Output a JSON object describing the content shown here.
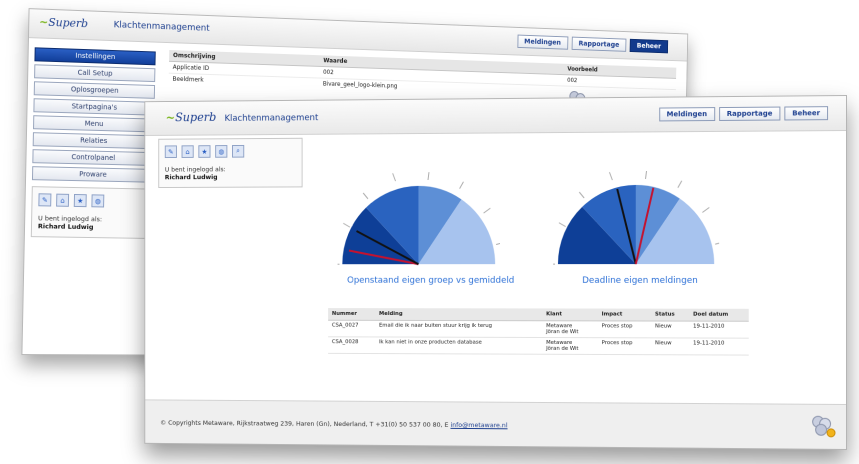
{
  "app": {
    "logo_text": "Superb",
    "title": "Klachtenmanagement"
  },
  "top_nav": [
    "Meldingen",
    "Rapportage",
    "Beheer"
  ],
  "back_window": {
    "sidebar_items": [
      "Instellingen",
      "Call Setup",
      "Oplosgroepen",
      "Startpagina's",
      "Menu",
      "Relaties",
      "Controlpanel",
      "Proware"
    ],
    "active_item": "Instellingen",
    "logged_in_label": "U bent ingelogd als:",
    "user_name": "Richard Ludwig",
    "table": {
      "headers": [
        "Omschrijving",
        "Waarde",
        "Voorbeeld"
      ],
      "rows": [
        [
          "Applicatie ID",
          "002",
          "002"
        ],
        [
          "Beeldmerk",
          "Bivare_geel_logo-klein.png",
          ""
        ]
      ]
    }
  },
  "front_window": {
    "logged_in_label": "U bent ingelogd als:",
    "user_name": "Richard Ludwig",
    "charts": [
      {
        "caption": "Openstaand eigen groep vs gemiddeld"
      },
      {
        "caption": "Deadline eigen meldingen"
      }
    ],
    "table": {
      "headers": [
        "Nummer",
        "Melding",
        "Klant",
        "Impact",
        "Status",
        "Doel datum"
      ],
      "rows": [
        {
          "nummer": "CSA_0027",
          "melding": "Email die ik naar buiten stuur krijg ik terug",
          "klant_1": "Metaware",
          "klant_2": "Jöran de Wit",
          "impact": "Proces stop",
          "status": "Nieuw",
          "datum": "19-11-2010"
        },
        {
          "nummer": "CSA_0028",
          "melding": "Ik kan niet in onze producten database",
          "klant_1": "Metaware",
          "klant_2": "Jöran de Wit",
          "impact": "Proces stop",
          "status": "Nieuw",
          "datum": "19-11-2010"
        }
      ]
    },
    "footer": {
      "text": "© Copyrights Metaware, Rijkstraatweg 239, Haren (Gn), Nederland, T +31(0) 50 537 00 80, E ",
      "email": "info@metaware.nl"
    }
  },
  "colors": {
    "brand_blue": "#1d3f8f",
    "brand_green": "#7ab51d",
    "gauge_dark": "#1b4fa8",
    "gauge_mid": "#3f78cc",
    "gauge_light": "#8fb4ea",
    "needle_red": "#c4122f"
  }
}
